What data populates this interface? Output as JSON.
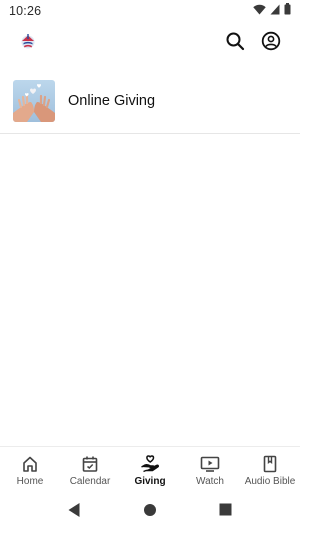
{
  "status_bar": {
    "time": "10:26",
    "icons": [
      "wifi-icon",
      "cellular-icon",
      "battery-icon"
    ]
  },
  "header": {
    "logo": "church-logo",
    "actions": [
      "search-icon",
      "profile-icon"
    ]
  },
  "list": {
    "items": [
      {
        "label": "Online Giving",
        "thumbnail": "hands-hearts-image"
      }
    ]
  },
  "bottom_nav": {
    "active": "Giving",
    "items": [
      {
        "label": "Home",
        "icon": "home-icon"
      },
      {
        "label": "Calendar",
        "icon": "calendar-icon"
      },
      {
        "label": "Giving",
        "icon": "giving-hand-heart-icon"
      },
      {
        "label": "Watch",
        "icon": "tv-play-icon"
      },
      {
        "label": "Audio Bible",
        "icon": "book-icon"
      }
    ]
  },
  "system_nav": {
    "buttons": [
      "back-icon",
      "home-circle-icon",
      "recents-icon"
    ]
  },
  "colors": {
    "background": "#ffffff",
    "divider": "#e6e6e6",
    "active_text": "#111111",
    "inactive_text": "#555555"
  }
}
